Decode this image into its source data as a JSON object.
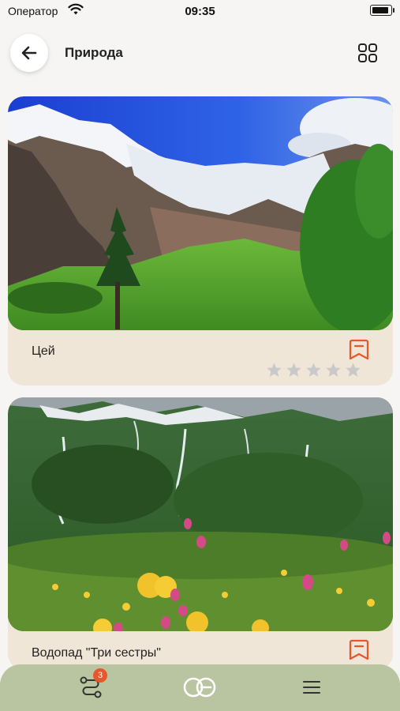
{
  "status_bar": {
    "carrier": "Оператор",
    "time": "09:35"
  },
  "header": {
    "title": "Природа"
  },
  "cards": [
    {
      "title": "Цей",
      "rating": 0,
      "max_rating": 5
    },
    {
      "title": "Водопад \"Три сестры\""
    }
  ],
  "tabbar": {
    "route_badge_count": "3"
  },
  "colors": {
    "accent": "#e8562c",
    "card_bg": "#efe6d8",
    "tabbar_bg": "#b9c4a0",
    "star_empty": "#c9c9c9"
  }
}
